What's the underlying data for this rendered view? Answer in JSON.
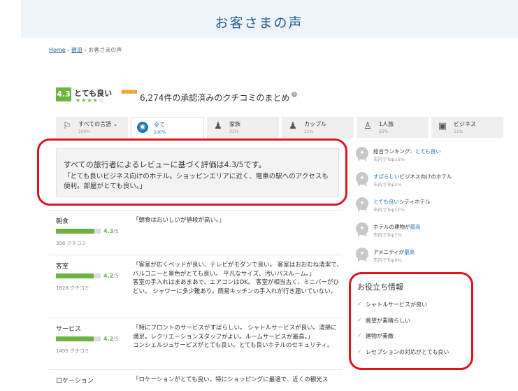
{
  "page_title": "お客さまの声",
  "breadcrumb": {
    "home": "Home",
    "sep1": "›",
    "lodging": "宿泊",
    "sep2": "›",
    "current": "お客さまの声"
  },
  "summary": {
    "score": "4.3",
    "rating_word": "とても良い",
    "stars": "★★★★☆",
    "text": "6,274件の承認済みのクチコミのまとめ",
    "info_icon": "i"
  },
  "tabs": [
    {
      "label": "すべての言語 ⌄",
      "pct": "100%",
      "icon": "language-icon",
      "glyph": "⚐"
    },
    {
      "label": "全て",
      "pct": "100%",
      "icon": "globe-icon",
      "glyph": "◉"
    },
    {
      "label": "家族",
      "pct": "33%",
      "icon": "family-icon",
      "glyph": "♟"
    },
    {
      "label": "カップル",
      "pct": "31%",
      "icon": "couple-icon",
      "glyph": "♟"
    },
    {
      "label": "1人旅",
      "pct": "25%",
      "icon": "solo-icon",
      "glyph": "♙"
    },
    {
      "label": "ビジネス",
      "pct": "11%",
      "icon": "briefcase-icon",
      "glyph": "▣"
    }
  ],
  "overall": {
    "head": "すべての旅行者によるレビューに基づく評価は4.3/5です。",
    "body": "「とても良いビジネス向けのホテル。ショッピンエリアに近く、電車の駅へのアクセスも便利。部屋がとても良い。」"
  },
  "categories": [
    {
      "name": "朝食",
      "score": "4.3",
      "max": "/5",
      "fraction": 0.86,
      "count": "398 クチコミ",
      "quote": "「朝食はおいしいが値段が高い。」"
    },
    {
      "name": "客室",
      "score": "4.2",
      "max": "/5",
      "fraction": 0.84,
      "count": "1828 クチコミ",
      "quote": "「客室が広くベッドが良い、テレビがモダンで良い。 客室はおおむね清潔で、バルコニーと景色がとても良い。 平凡なサイズ、汚いバスルーム。」\n客室の手入れはまあまあで、エアコンはOK。 客室が相当古く、ミニバーがひどい。 シャワーに多少難あり。簡易キッチンの手入れが行き届いていない。"
    },
    {
      "name": "サービス",
      "score": "4.2",
      "max": "/5",
      "fraction": 0.84,
      "count": "1495 クチコミ",
      "quote": "「特にフロントのサービスがすばらしい。 シャトルサービスが良い。清掃に満足。レクリエーションスタッフがよい。ルームサービスが最高。」\nコンシェルジュサービスがとても良い。とても良いホテルのセキュリティ。"
    },
    {
      "name": "ロケーション",
      "score": "",
      "max": "",
      "fraction": 0,
      "count": "",
      "quote": "「ロケーションがとても良い。特にショッピングに最適で、近くの観光ス"
    }
  ],
  "rankings": [
    {
      "prefix": "総合ランキング：",
      "highlight": "とても良い",
      "suffix": "",
      "sub": "市内でTop16%"
    },
    {
      "prefix": "",
      "highlight": "すばらしい",
      "suffix": "ビジネス向けのホテル",
      "sub": "市内でTop2%"
    },
    {
      "prefix": "",
      "highlight": "とても良い",
      "suffix": "シティホテル",
      "sub": "市内でTop11%"
    },
    {
      "prefix": "ホテルの建物が",
      "highlight": "最高",
      "suffix": "",
      "sub": "市内でTop7%"
    },
    {
      "prefix": "アメニティが",
      "highlight": "最高",
      "suffix": "",
      "sub": "市内でTop9%"
    }
  ],
  "helpful": {
    "title": "お役立ち情報",
    "items": [
      "シャトルサービスが良い",
      "眺望が素晴らしい",
      "建物が素敵",
      "レセプションの対応がとても良い"
    ]
  },
  "colors": {
    "accent_green": "#6cb33f",
    "link_blue": "#1f76b5",
    "highlight_red": "#e0141e"
  }
}
